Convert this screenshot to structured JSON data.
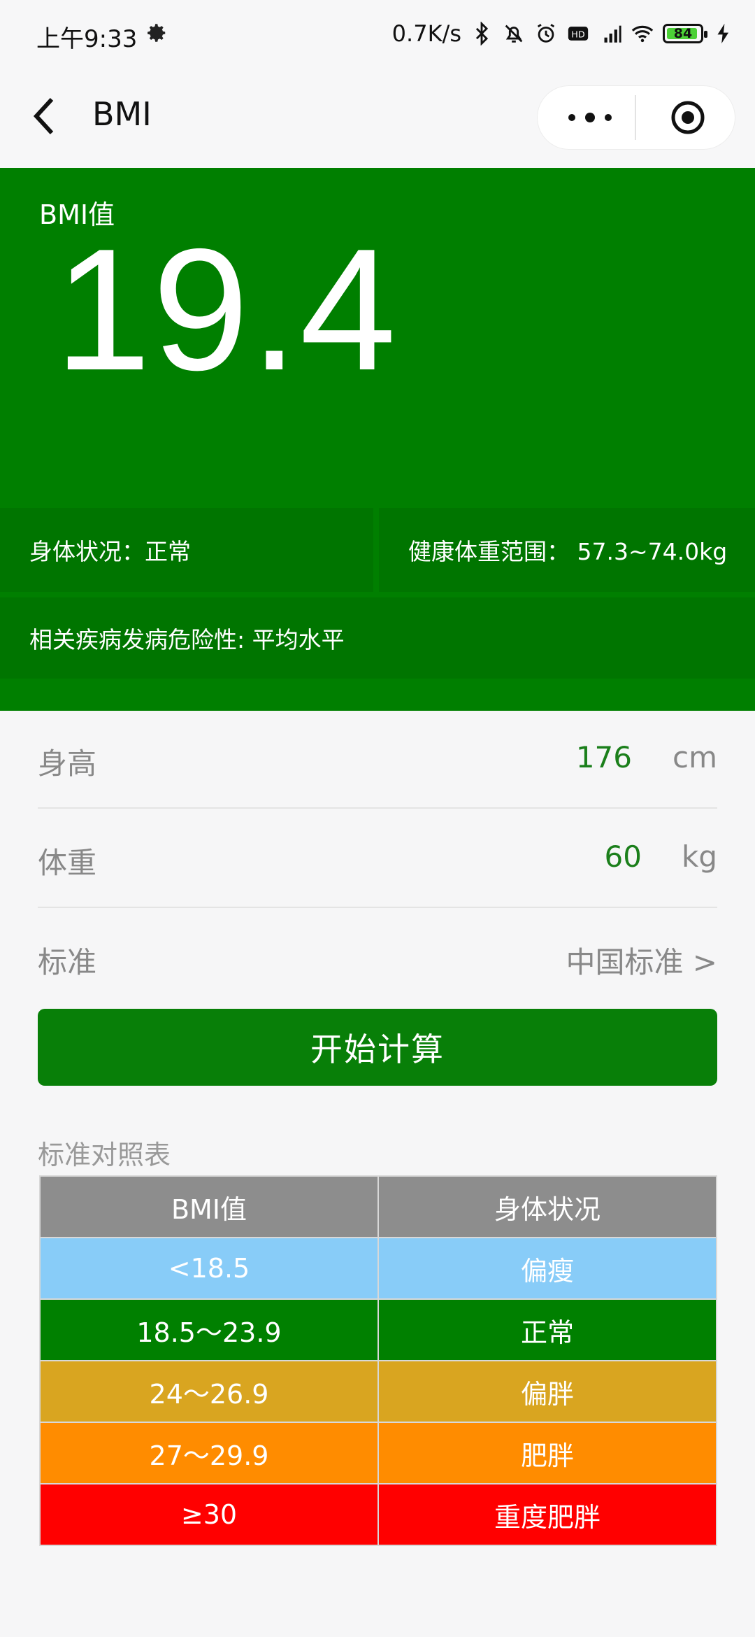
{
  "status_bar": {
    "time": "上午9:33",
    "net_speed": "0.7K/s",
    "battery": "84",
    "icons": [
      "gear-icon",
      "bluetooth-icon",
      "mute-bell-icon",
      "alarm-icon",
      "hd-icon",
      "signal-icon",
      "wifi-icon",
      "battery-icon",
      "charging-icon"
    ]
  },
  "nav": {
    "title": "BMI"
  },
  "result": {
    "label": "BMI值",
    "value": "19.4",
    "status": "身体状况：正常",
    "healthy_range": "健康体重范围：  57.3~74.0kg",
    "risk": "相关疾病发病危险性: 平均水平",
    "color": "#007f00"
  },
  "form": {
    "height_label": "身高",
    "height_value": "176",
    "height_unit": "cm",
    "weight_label": "体重",
    "weight_value": "60",
    "weight_unit": "kg",
    "standard_label": "标准",
    "standard_value": "中国标准  >"
  },
  "button": {
    "label": "开始计算"
  },
  "table": {
    "title": "标准对照表",
    "headers": [
      "BMI值",
      "身体状况"
    ],
    "rows": [
      {
        "range": "<18.5",
        "status": "偏瘦",
        "color": "#88ccf8"
      },
      {
        "range": "18.5～23.9",
        "status": "正常",
        "color": "#008000"
      },
      {
        "range": "24～26.9",
        "status": "偏胖",
        "color": "#d9a520"
      },
      {
        "range": "27～29.9",
        "status": "肥胖",
        "color": "#ff8c00"
      },
      {
        "range": "≥30",
        "status": "重度肥胖",
        "color": "#ff0000"
      }
    ]
  }
}
